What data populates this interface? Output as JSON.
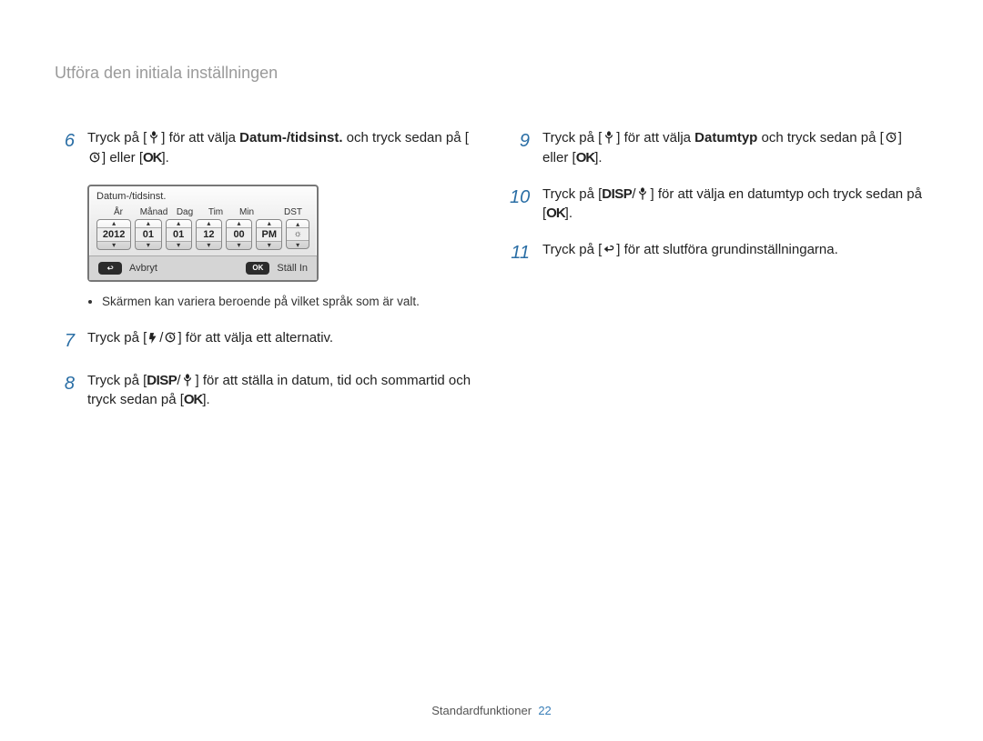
{
  "page_title": "Utföra den initiala inställningen",
  "footer_section": "Standardfunktioner",
  "footer_page": "22",
  "steps": {
    "s6_a": "Tryck på [",
    "s6_b": "] för att välja ",
    "s6_bold": "Datum-/tidsinst.",
    "s6_c": " och tryck sedan på [",
    "s6_d": "] eller [",
    "s6_e": "].",
    "s7_a": "Tryck på [",
    "s7_b": "/",
    "s7_c": "] för att välja ett alternativ.",
    "s8_a": "Tryck på [",
    "s8_b": "/",
    "s8_c": "] för att ställa in datum, tid och sommartid och tryck sedan på [",
    "s8_d": "].",
    "s9_a": "Tryck på [",
    "s9_b": "] för att välja ",
    "s9_bold": "Datumtyp",
    "s9_c": " och tryck sedan på [",
    "s9_d": "] eller [",
    "s9_e": "].",
    "s10_a": "Tryck på [",
    "s10_b": "/",
    "s10_c": "] för att välja en datumtyp och tryck sedan på [",
    "s10_d": "].",
    "s11_a": "Tryck på [",
    "s11_b": "] för att slutföra grundinställningarna."
  },
  "step_numbers": {
    "n6": "6",
    "n7": "7",
    "n8": "8",
    "n9": "9",
    "n10": "10",
    "n11": "11"
  },
  "note": "Skärmen kan variera beroende på vilket språk som är valt.",
  "dt": {
    "title": "Datum-/tidsinst.",
    "hdr_year": "År",
    "hdr_month": "Månad",
    "hdr_day": "Dag",
    "hdr_hour": "Tim",
    "hdr_min": "Min",
    "hdr_dst": "DST",
    "year": "2012",
    "month": "01",
    "day": "01",
    "hour": "12",
    "min": "00",
    "ampm": "PM",
    "cancel": "Avbryt",
    "set": "Ställ In",
    "ok_badge": "OK"
  },
  "icons": {
    "macro": "macro-icon",
    "timer": "timer-icon",
    "ok": "OK",
    "disp": "DISP",
    "flash": "flash-icon",
    "back": "back-icon"
  }
}
